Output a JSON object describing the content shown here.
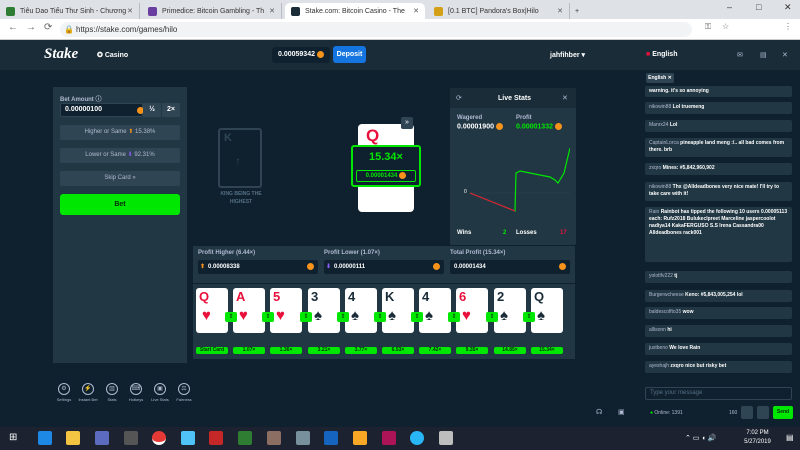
{
  "browser": {
    "tabs": [
      {
        "label": "Tiêu Dao Tiểu Thư Sinh - Chương",
        "favicon_color": "#2e7d32"
      },
      {
        "label": "Primedice: Bitcoin Gambling - Th",
        "favicon_color": "#6a3ea1"
      },
      {
        "label": "Stake.com: Bitcoin Casino - The",
        "favicon_color": "#1a2c38"
      },
      {
        "label": "[0.1 BTC] Pandora's Box|Hilo",
        "favicon_color": "#d4a017"
      }
    ],
    "url": "https://stake.com/games/hilo"
  },
  "header": {
    "logo": "Stake",
    "casino": "Casino",
    "balance": "0.00059342",
    "deposit": "Deposit",
    "username": "jahfihber",
    "language": "English"
  },
  "bet_panel": {
    "bet_amount_label": "Bet Amount",
    "bet_amount": "0.00000100",
    "half": "½",
    "double": "2×",
    "higher_label": "Higher or Same",
    "higher_pct": "15.38%",
    "lower_label": "Lower or Same",
    "lower_pct": "92.31%",
    "skip": "Skip Card",
    "bet_button": "Bet"
  },
  "game": {
    "king_caption": "KING BEING THE HIGHEST",
    "king_rank": "K",
    "current_card_rank": "Q",
    "multiplier": "15.34×",
    "multiplier_profit": "0.00001434"
  },
  "live_stats": {
    "title": "Live Stats",
    "wagered_label": "Wagered",
    "wagered": "0.00001900",
    "profit_label": "Profit",
    "profit": "0.00001332",
    "zero_label": "0",
    "wins_label": "Wins",
    "wins": "2",
    "losses_label": "Losses",
    "losses": "17"
  },
  "profit_row": {
    "higher_label": "Profit Higher (6.44×)",
    "higher": "0.00008338",
    "lower_label": "Profit Lower (1.07×)",
    "lower": "0.00000111",
    "total_label": "Total Profit (15.34×)",
    "total": "0.00001434"
  },
  "cards": [
    {
      "rank": "Q",
      "suit": "♥",
      "color": "red",
      "label": "Start Card"
    },
    {
      "rank": "A",
      "suit": "♥",
      "color": "red",
      "label": "1.07×"
    },
    {
      "rank": "5",
      "suit": "♥",
      "color": "red",
      "label": "1.36×"
    },
    {
      "rank": "3",
      "suit": "♠",
      "color": "blk",
      "label": "3.21×"
    },
    {
      "rank": "4",
      "suit": "♠",
      "color": "blk",
      "label": "3.77×"
    },
    {
      "rank": "K",
      "suit": "♠",
      "color": "blk",
      "label": "6.53×"
    },
    {
      "rank": "4",
      "suit": "♠",
      "color": "blk",
      "label": "7.42×"
    },
    {
      "rank": "6",
      "suit": "♥",
      "color": "red",
      "label": "9.35×"
    },
    {
      "rank": "2",
      "suit": "♠",
      "color": "blk",
      "label": "14.85×"
    },
    {
      "rank": "Q",
      "suit": "♠",
      "color": "blk",
      "label": "15.34×"
    }
  ],
  "footer": [
    "Settings",
    "Instant Bet",
    "Stats",
    "Hotkeys",
    "Live Stats",
    "Fairness"
  ],
  "chat": {
    "tab": "English",
    "messages": [
      {
        "user": "",
        "text": "warning. it's so annoying"
      },
      {
        "user": "nikowin88",
        "text": "Lol truemeng"
      },
      {
        "user": "Manrx24",
        "text": "Lol"
      },
      {
        "user": "CaptainLorca",
        "text": "pineapple land meng :/.. all bad comes from there. brb"
      },
      {
        "user": "zxqro",
        "text": "Mines: #5,842,960,902"
      },
      {
        "user": "nikowin88",
        "text": "Thx @Alldeadbones very nice mate! I'll try to take care with it!"
      },
      {
        "user": "Rain",
        "text": "Rainbot has tipped the following 10 users 0.00005113 each: Rufz2018 BulukecIpreet Marceline jaspercoolot nadiya14 KakaFERGUSO S.S Irena Cassandra00 Alldeadbones rack001"
      },
      {
        "user": "yolotlfv222",
        "text": "tj"
      },
      {
        "user": "Burgerwcheese",
        "text": "Keno: #5,843,005,254 lol"
      },
      {
        "user": "baldescolfto35",
        "text": "wow"
      },
      {
        "user": "allisonn",
        "text": "hi"
      },
      {
        "user": "justbeno",
        "text": "We love Rain"
      },
      {
        "user": "ayeshajh",
        "text": "zxqro nice but risky bet"
      }
    ],
    "input_placeholder": "Type your message",
    "online": "Online: 1391",
    "count": "160",
    "send": "Send"
  },
  "taskbar": {
    "time": "7:02 PM",
    "date": "5/27/2019"
  }
}
